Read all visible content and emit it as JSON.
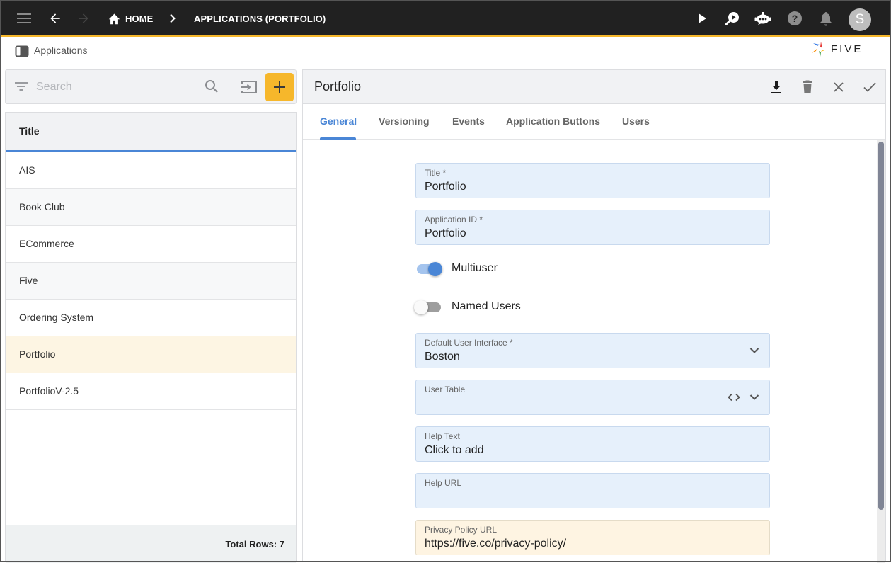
{
  "topbar": {
    "menu_icon": "hamburger-menu-icon",
    "back_icon": "arrow-left-icon",
    "forward_icon": "arrow-right-icon",
    "breadcrumb": [
      {
        "label": "HOME",
        "icon": "home-icon"
      },
      {
        "label": "APPLICATIONS (PORTFOLIO)"
      }
    ],
    "actions": [
      "play-icon",
      "search-play-icon",
      "chatbot-icon",
      "help-icon",
      "bell-icon"
    ],
    "avatar_initial": "S",
    "accent_color": "#f6b72b"
  },
  "subheader": {
    "title": "Applications",
    "logo_text": "FIVE"
  },
  "list_panel": {
    "search_placeholder": "Search",
    "column_header": "Title",
    "rows": [
      "AIS",
      "Book Club",
      "ECommerce",
      "Five",
      "Ordering System",
      "Portfolio",
      "PortfolioV-2.5"
    ],
    "selected_row": "Portfolio",
    "footer": "Total Rows: 7"
  },
  "form": {
    "title": "Portfolio",
    "tabs": [
      "General",
      "Versioning",
      "Events",
      "Application Buttons",
      "Users"
    ],
    "active_tab": "General",
    "fields": {
      "title": {
        "label": "Title *",
        "value": "Portfolio"
      },
      "application_id": {
        "label": "Application ID *",
        "value": "Portfolio"
      },
      "multiuser": {
        "label": "Multiuser",
        "on": true
      },
      "named_users": {
        "label": "Named Users",
        "on": false
      },
      "default_ui": {
        "label": "Default User Interface *",
        "value": "Boston"
      },
      "user_table": {
        "label": "User Table",
        "value": ""
      },
      "help_text": {
        "label": "Help Text",
        "value": "Click to add"
      },
      "help_url": {
        "label": "Help URL",
        "value": ""
      },
      "privacy_url": {
        "label": "Privacy Policy URL",
        "value": "https://five.co/privacy-policy/"
      }
    },
    "primary_color": "#4a86d6"
  }
}
